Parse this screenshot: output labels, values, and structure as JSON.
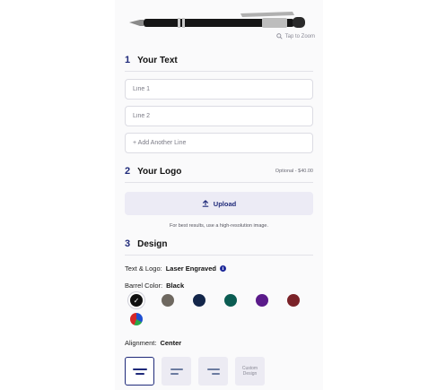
{
  "product": {
    "zoom_label": "Tap to Zoom",
    "icon": "zoom-icon"
  },
  "step1": {
    "number": "1",
    "title": "Your Text",
    "line1_placeholder": "Line 1",
    "line2_placeholder": "Line 2",
    "add_line": "+ Add Another Line"
  },
  "step2": {
    "number": "2",
    "title": "Your Logo",
    "optional": "Optional - $40.00",
    "upload_label": "Upload",
    "upload_icon": "upload-arrow-icon",
    "hint": "For best results, use a high-resolution image."
  },
  "step3": {
    "number": "3",
    "title": "Design",
    "text_logo_label": "Text & Logo:",
    "text_logo_value": "Laser Engraved",
    "info_glyph": "i",
    "barrel_label": "Barrel Color:",
    "barrel_value": "Black",
    "colors": [
      "#111111",
      "#6e6860",
      "#13264a",
      "#0b5c52",
      "#5a1a8a",
      "#7a2228"
    ],
    "multi_colors": [
      "#d62828",
      "#1f4fd1",
      "#2aa84a"
    ],
    "alignment_label": "Alignment:",
    "alignment_value": "Center",
    "custom_design_line1": "Custom",
    "custom_design_line2": "Design"
  }
}
